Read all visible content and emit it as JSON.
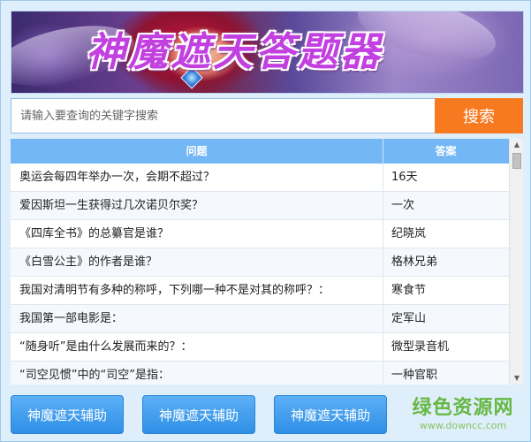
{
  "banner": {
    "title": "神魔遮天答题器"
  },
  "search": {
    "placeholder": "请输入要查询的关键字搜索",
    "button_label": "搜索"
  },
  "table": {
    "columns": {
      "question": "问题",
      "answer": "答案"
    },
    "rows": [
      {
        "question": "奥运会每四年举办一次，会期不超过？",
        "answer": "16天"
      },
      {
        "question": "爱因斯坦一生获得过几次诺贝尔奖？",
        "answer": "一次"
      },
      {
        "question": "《四库全书》的总纂官是谁？",
        "answer": "纪晓岚"
      },
      {
        "question": "《白雪公主》的作者是谁？",
        "answer": "格林兄弟"
      },
      {
        "question": "我国对清明节有多种的称呼，下列哪一种不是对其的称呼？：",
        "answer": "寒食节"
      },
      {
        "question": "我国第一部电影是：",
        "answer": "定军山"
      },
      {
        "question": "“随身听”是由什么发展而来的？：",
        "answer": "微型录音机"
      },
      {
        "question": "“司空见惯”中的“司空”是指：",
        "answer": "一种官职"
      }
    ]
  },
  "bottom": {
    "buttons": [
      "神魔遮天辅助",
      "神魔遮天辅助",
      "神魔遮天辅助"
    ],
    "watermark": {
      "logo": "绿色资源网",
      "url": "www.downcc.com"
    }
  },
  "colors": {
    "accent_orange": "#f87a20",
    "header_blue": "#73b7f4",
    "button_blue": "#2f8fe6"
  },
  "icons": {
    "scroll_up": "▲",
    "scroll_down": "▼"
  }
}
